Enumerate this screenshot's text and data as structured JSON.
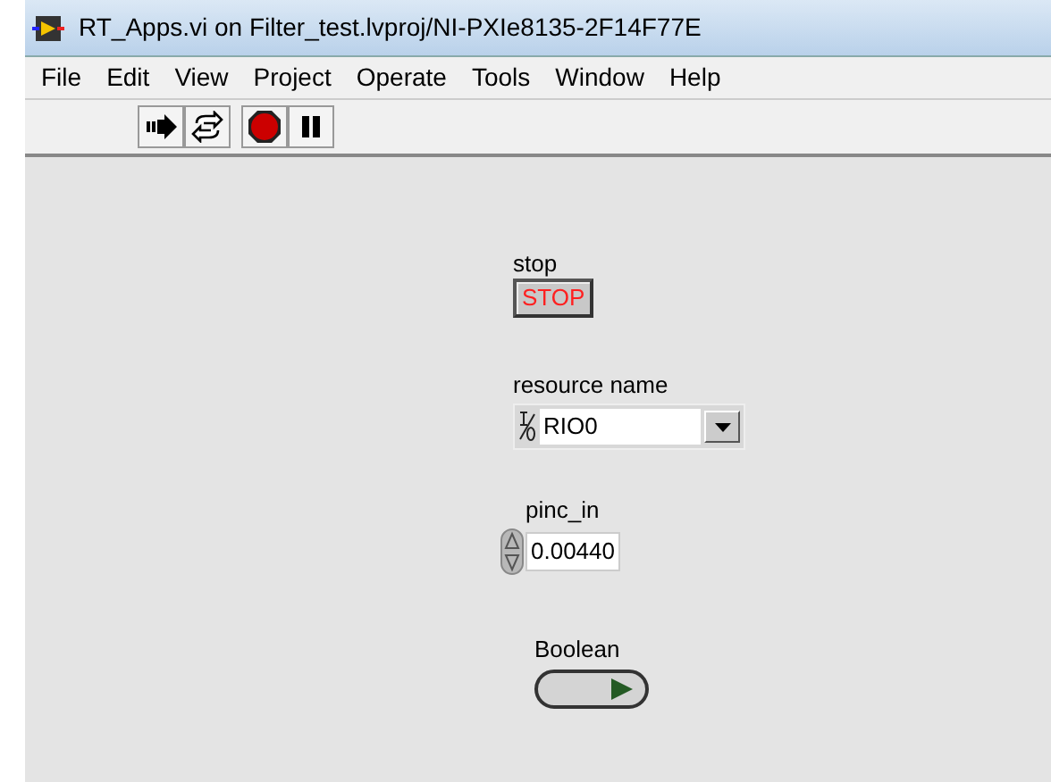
{
  "window": {
    "title": "RT_Apps.vi on Filter_test.lvproj/NI-PXIe8135-2F14F77E"
  },
  "menu": [
    "File",
    "Edit",
    "View",
    "Project",
    "Operate",
    "Tools",
    "Window",
    "Help"
  ],
  "toolbar": [
    {
      "kind": "run"
    },
    {
      "kind": "run_continuously"
    },
    {
      "kind": "abort"
    },
    {
      "kind": "pause"
    }
  ],
  "controls": [
    {
      "kind": "button",
      "label": "stop",
      "text": "STOP"
    },
    {
      "kind": "ioname",
      "label": "resource name",
      "value": "RIO0"
    },
    {
      "kind": "numeric",
      "label": "pinc_in",
      "value": "0.00440"
    },
    {
      "kind": "led",
      "label": "Boolean",
      "on": false
    }
  ]
}
